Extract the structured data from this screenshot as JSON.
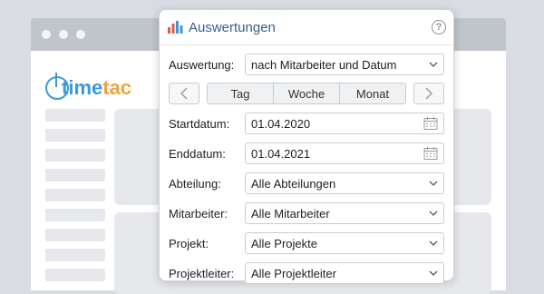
{
  "background": {
    "logo": {
      "part1": "time",
      "part2": "tac"
    }
  },
  "dialog": {
    "title": "Auswertungen",
    "help": "?",
    "period": {
      "day": "Tag",
      "week": "Woche",
      "month": "Monat"
    },
    "fields": [
      {
        "label": "Auswertung:",
        "value": "nach Mitarbeiter und Datum",
        "type": "select"
      },
      {
        "label": "Startdatum:",
        "value": "01.04.2020",
        "type": "date"
      },
      {
        "label": "Enddatum:",
        "value": "01.04.2021",
        "type": "date"
      },
      {
        "label": "Abteilung:",
        "value": "Alle Abteilungen",
        "type": "select"
      },
      {
        "label": "Mitarbeiter:",
        "value": "Alle Mitarbeiter",
        "type": "select"
      },
      {
        "label": "Projekt:",
        "value": "Alle Projekte",
        "type": "select"
      },
      {
        "label": "Projektleiter:",
        "value": "Alle Projektleiter",
        "type": "select"
      }
    ]
  },
  "colors": {
    "accent": "#3a9ad9",
    "brand_orange": "#f0a33a",
    "title": "#3a5d8c"
  }
}
